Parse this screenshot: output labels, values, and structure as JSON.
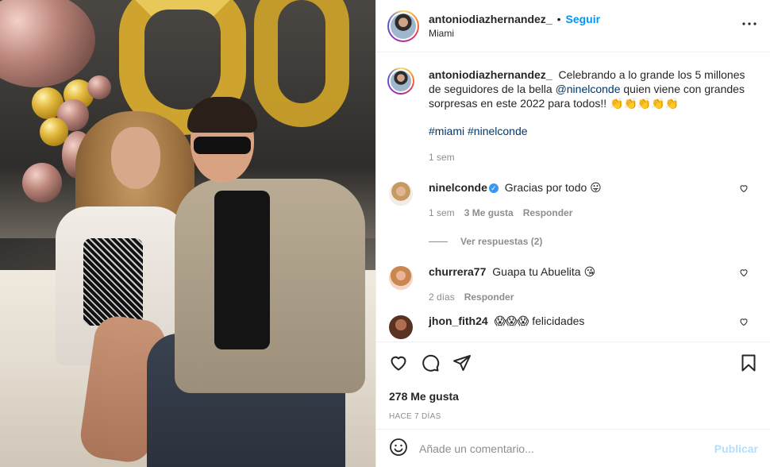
{
  "header": {
    "username": "antoniodiazhernandez_",
    "separator": "•",
    "follow_label": "Seguir",
    "location": "Miami",
    "more_icon": "more-horizontal-icon"
  },
  "post": {
    "author": "antoniodiazhernandez_",
    "caption_before": "Celebrando a lo grande los 5 millones de seguidores de la bella",
    "mention": "@ninelconde",
    "caption_after": "quien viene con grandes sorpresas en este 2022 para todos!! 👏👏👏👏👏",
    "hashtag1": "#miami",
    "hashtag2": "#ninelconde",
    "time": "1 sem"
  },
  "comments": [
    {
      "username": "ninelconde",
      "text": "Gracias por todo 😛",
      "time": "1 sem",
      "likes": "3 Me gusta",
      "reply_label": "Responder",
      "view_replies": "Ver respuestas (2)"
    },
    {
      "username": "churrera77",
      "text": "Guapa tu Abuelita 😘",
      "time": "2 días",
      "reply_label": "Responder"
    },
    {
      "username": "jhon_fith24",
      "text": "😱😱😱 felicidades"
    }
  ],
  "actions": {
    "likes": "278 Me gusta",
    "ago": "HACE 7 DÍAS"
  },
  "add_comment": {
    "placeholder": "Añade un comentario...",
    "publish_label": "Publicar"
  },
  "colors": {
    "accent": "#0095f6",
    "publish_disabled": "#b2dffc",
    "verified": "#3897f0",
    "muted": "#8e8e8e"
  }
}
